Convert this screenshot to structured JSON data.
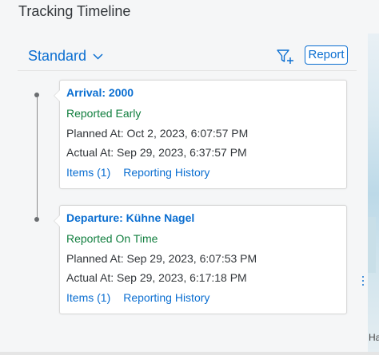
{
  "page": {
    "title": "Tracking Timeline"
  },
  "toolbar": {
    "variant_label": "Standard",
    "variant_icon": "chevron-down-icon",
    "filter_icon": "filter-add-icon",
    "report_label": "Report"
  },
  "timeline": {
    "events": [
      {
        "title": "Arrival: 2000",
        "status": "Reported Early",
        "status_color": "#107e3e",
        "planned": "Planned At: Oct 2, 2023, 6:07:57 PM",
        "actual": "Actual At: Sep 29, 2023, 6:37:57 PM",
        "items_link": "Items (1)",
        "history_link": "Reporting History"
      },
      {
        "title": "Departure: Kühne Nagel",
        "status": "Reported On Time",
        "status_color": "#107e3e",
        "planned": "Planned At: Sep 29, 2023, 6:07:53 PM",
        "actual": "Actual At: Sep 29, 2023, 6:17:18 PM",
        "items_link": "Items (1)",
        "history_link": "Reporting History"
      }
    ]
  },
  "map": {
    "edge_label": "Ha"
  },
  "colors": {
    "accent": "#0a6ed1",
    "positive": "#107e3e",
    "text": "#32363a"
  }
}
